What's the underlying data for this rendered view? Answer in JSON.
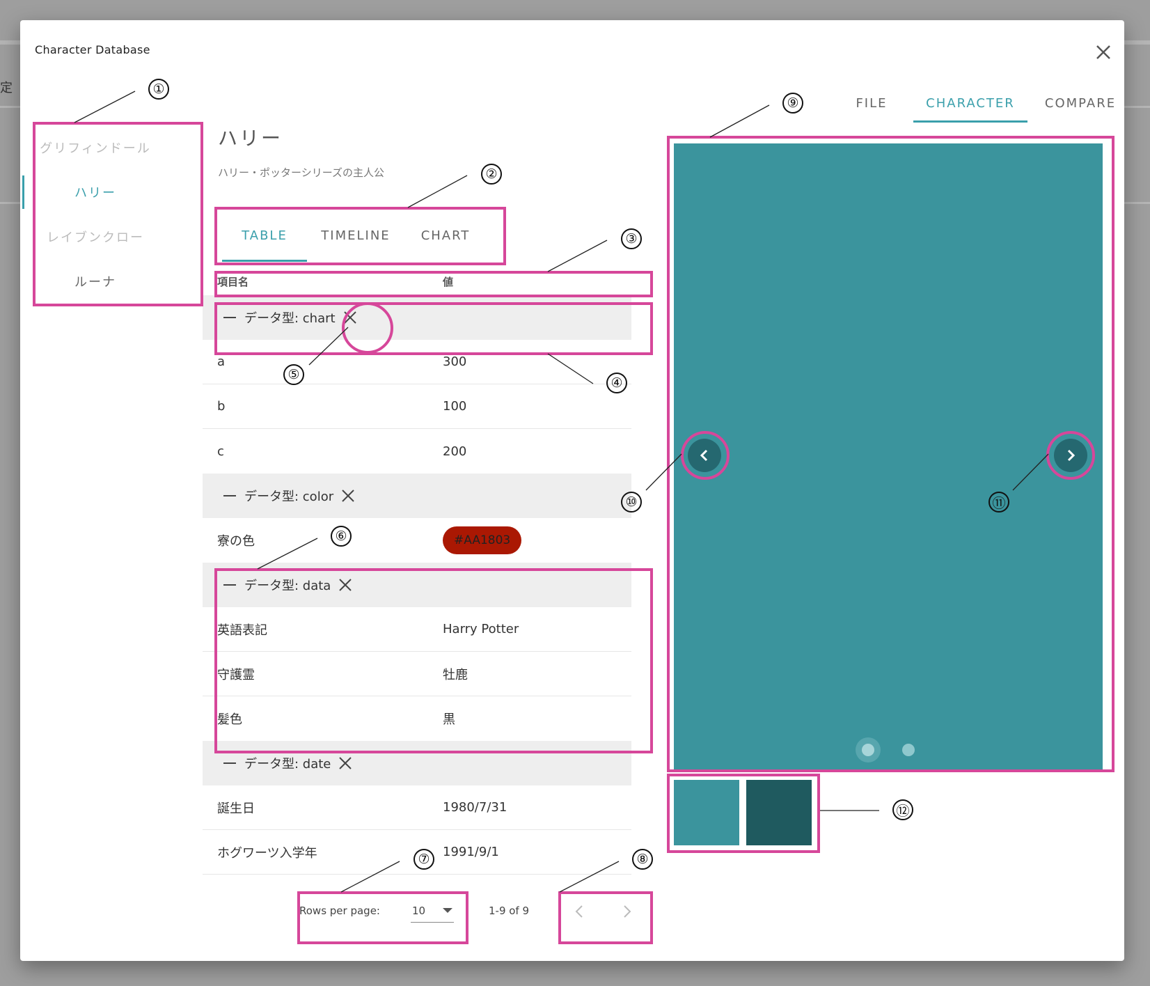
{
  "backdrop": {
    "partial_char": "定"
  },
  "dialog": {
    "title": "Character Database"
  },
  "nav": {
    "items": [
      {
        "label": "グリフィンドール"
      },
      {
        "label": "ハリー"
      },
      {
        "label": "レイブンクロー"
      },
      {
        "label": "ルーナ"
      }
    ]
  },
  "character": {
    "name": "ハリー",
    "description": "ハリー・ポッターシリーズの主人公"
  },
  "inner_tabs": [
    "TABLE",
    "TIMELINE",
    "CHART"
  ],
  "table": {
    "headers": {
      "key": "項目名",
      "value": "値"
    },
    "groups": [
      {
        "label": "データ型: chart",
        "rows": [
          {
            "k": "a",
            "v": "300"
          },
          {
            "k": "b",
            "v": "100"
          },
          {
            "k": "c",
            "v": "200"
          }
        ]
      },
      {
        "label": "データ型: color",
        "rows": [
          {
            "k": "寮の色",
            "v": "#AA1803"
          }
        ]
      },
      {
        "label": "データ型: data",
        "rows": [
          {
            "k": "英語表記",
            "v": "Harry Potter"
          },
          {
            "k": "守護霊",
            "v": "牡鹿"
          },
          {
            "k": "髪色",
            "v": "黒"
          }
        ]
      },
      {
        "label": "データ型: date",
        "rows": [
          {
            "k": "誕生日",
            "v": "1980/7/31"
          },
          {
            "k": "ホグワーツ入学年",
            "v": "1991/9/1"
          }
        ]
      }
    ]
  },
  "pagination": {
    "rows_per_page_label": "Rows per page:",
    "rows_per_page_value": "10",
    "range": "1-9 of 9"
  },
  "right_tabs": [
    "FILE",
    "CHARACTER",
    "COMPARE"
  ],
  "colors": {
    "accent": "#3a9fab",
    "chip": "#AA1803",
    "carousel_bg": "#3b949d",
    "thumb_1": "#3b949d",
    "thumb_2": "#1f5a5f",
    "annotation": "#d6479a"
  },
  "annotations": [
    "①",
    "②",
    "③",
    "④",
    "⑤",
    "⑥",
    "⑦",
    "⑧",
    "⑨",
    "⑩",
    "⑪",
    "⑫"
  ]
}
